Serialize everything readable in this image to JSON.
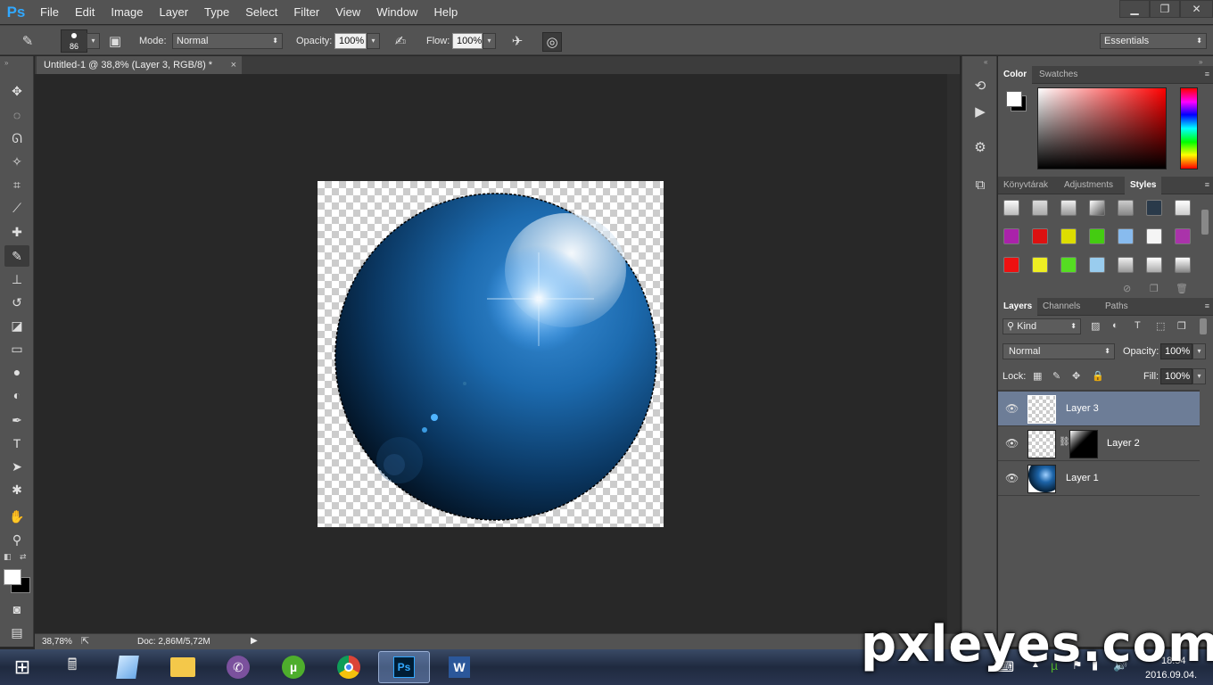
{
  "app": {
    "logo": "Ps"
  },
  "menu": [
    "File",
    "Edit",
    "Image",
    "Layer",
    "Type",
    "Select",
    "Filter",
    "View",
    "Window",
    "Help"
  ],
  "window_controls": {
    "minimize": "▁",
    "restore": "❐",
    "close": "✕"
  },
  "options_bar": {
    "brush_size": "86",
    "mode_label": "Mode:",
    "mode_value": "Normal",
    "opacity_label": "Opacity:",
    "opacity_value": "100%",
    "flow_label": "Flow:",
    "flow_value": "100%",
    "workspace": "Essentials"
  },
  "document_tab": {
    "title": "Untitled-1 @ 38,8% (Layer 3, RGB/8) *",
    "close": "×"
  },
  "status": {
    "zoom": "38,78%",
    "doc": "Doc: 2,86M/5,72M"
  },
  "color_panel": {
    "tabs": [
      "Color",
      "Swatches"
    ]
  },
  "styles_panel": {
    "tabs": [
      "Könyvtárak",
      "Adjustments",
      "Styles"
    ]
  },
  "layers_panel": {
    "tabs": [
      "Layers",
      "Channels",
      "Paths"
    ],
    "filter_kind": "Kind",
    "blend_mode": "Normal",
    "opacity_label": "Opacity:",
    "opacity_value": "100%",
    "lock_label": "Lock:",
    "fill_label": "Fill:",
    "fill_value": "100%",
    "layers": [
      {
        "name": "Layer 3",
        "selected": true
      },
      {
        "name": "Layer 2",
        "selected": false
      },
      {
        "name": "Layer 1",
        "selected": false
      }
    ]
  },
  "taskbar": {
    "time": "18:54",
    "date": "2016.09.04."
  },
  "watermark": "pxleyes.com",
  "colors": {
    "accent_selected": "#6d7d97",
    "ps_blue": "#31a8ff"
  }
}
